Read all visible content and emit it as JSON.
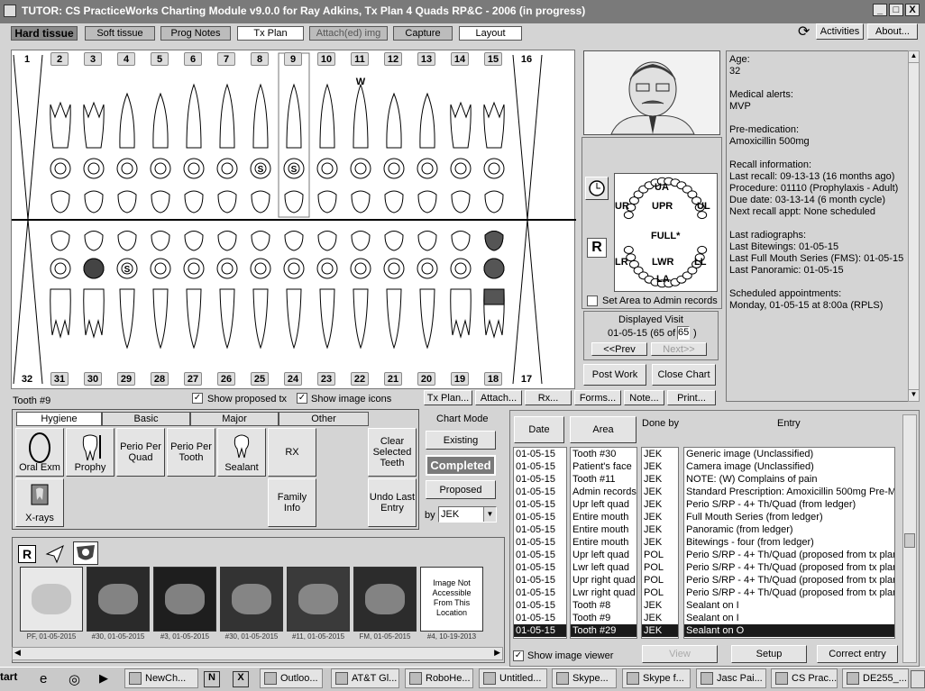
{
  "window": {
    "title": "TUTOR: CS PracticeWorks Charting Module v9.0.0 for Ray Adkins, Tx Plan 4 Quads RP&C - 2006 (in progress)",
    "min": "_",
    "max": "□",
    "close": "X"
  },
  "tabs": [
    "Hard tissue",
    "Soft tissue",
    "Prog Notes",
    "Tx Plan",
    "Attach(ed) img",
    "Capture",
    "Layout"
  ],
  "header_buttons": {
    "activities": "Activities",
    "about": "About..."
  },
  "teeth_top": [
    "1",
    "2",
    "3",
    "4",
    "5",
    "6",
    "7",
    "8",
    "9",
    "10",
    "11",
    "12",
    "13",
    "14",
    "15",
    "16"
  ],
  "teeth_bottom": [
    "32",
    "31",
    "30",
    "29",
    "28",
    "27",
    "26",
    "25",
    "24",
    "23",
    "22",
    "21",
    "20",
    "19",
    "18",
    "17"
  ],
  "marks": {
    "w": "W",
    "s1": "S",
    "s2": "S",
    "s3": "S"
  },
  "chart_bar": {
    "tooth_label": "Tooth #9",
    "show_proposed": "Show proposed tx",
    "show_image_icons": "Show image icons",
    "buttons": [
      "Tx Plan...",
      "Attach...",
      "Rx...",
      "Forms...",
      "Note...",
      "Print..."
    ]
  },
  "patient": {
    "age_label": "Age:",
    "age": "32",
    "alerts_label": "Medical alerts:",
    "alerts": "MVP",
    "premed_label": "Pre-medication:",
    "premed": "Amoxicillin 500mg",
    "recall_label": "Recall information:",
    "recall": [
      "Last recall: 09-13-13 (16 months ago)",
      "Procedure: 01110 (Prophylaxis - Adult)",
      "Due date: 03-13-14 (6 month cycle)",
      "Next recall appt: None scheduled"
    ],
    "radiographs_label": "Last radiographs:",
    "radiographs": [
      "Last Bitewings: 01-05-15",
      "Last Full Mouth Series (FMS): 01-05-15",
      "Last Panoramic: 01-05-15"
    ],
    "sched_label": "Scheduled appointments:",
    "sched": "Monday, 01-05-15 at  8:00a (RPLS)"
  },
  "area_map": {
    "ua": "UA",
    "upr": "UPR",
    "ul": "UL",
    "ur": "UR",
    "full": "FULL*",
    "lr": "LR",
    "lwr": "LWR",
    "ll": "LL",
    "la": "LA",
    "set_area": "Set Area to Admin records",
    "clock_icon": "clock-icon",
    "rx": "R"
  },
  "visit": {
    "label": "Displayed Visit",
    "date": "01-05-15 (65 of",
    "total": "65",
    "close_paren": ")",
    "prev": "<<Prev",
    "next": "Next>>",
    "post_work": "Post Work",
    "close_chart": "Close Chart"
  },
  "proc_tabs": [
    "Hygiene",
    "Basic",
    "Major",
    "Other"
  ],
  "proc_buttons": {
    "oral_exm": "Oral Exm",
    "prophy": "Prophy",
    "perio_quad": "Perio Per Quad",
    "perio_tooth": "Perio Per Tooth",
    "sealant": "Sealant",
    "rx": "RX",
    "xrays": "X-rays",
    "family": "Family Info",
    "clear": "Clear Selected Teeth",
    "undo": "Undo Last Entry"
  },
  "chart_mode": {
    "label": "Chart Mode",
    "existing": "Existing",
    "completed": "Completed",
    "proposed": "Proposed",
    "by_label": "by",
    "by_value": "JEK"
  },
  "images": {
    "r": "R",
    "items": [
      {
        "cap": "PF, 01-05-2015"
      },
      {
        "cap": "#30, 01-05-2015"
      },
      {
        "cap": "#3, 01-05-2015"
      },
      {
        "cap": "#30, 01-05-2015"
      },
      {
        "cap": "#11, 01-05-2015"
      },
      {
        "cap": "FM, 01-05-2015"
      },
      {
        "cap": "#4, 10-19-2013",
        "text": "Image Not Accessible From This Location"
      }
    ]
  },
  "ledger": {
    "headers": {
      "date": "Date",
      "area": "Area",
      "done_by": "Done by",
      "entry": "Entry"
    },
    "rows": [
      {
        "date": "01-05-15",
        "area": "Tooth #30",
        "by": "JEK",
        "entry": "Generic image (Unclassified)"
      },
      {
        "date": "01-05-15",
        "area": "Patient's face",
        "by": "JEK",
        "entry": "Camera image (Unclassified)"
      },
      {
        "date": "01-05-15",
        "area": "Tooth #11",
        "by": "JEK",
        "entry": "NOTE: (W) Complains of pain"
      },
      {
        "date": "01-05-15",
        "area": "Admin records",
        "by": "JEK",
        "entry": "Standard Prescription:  Amoxicillin 500mg Pre-Me"
      },
      {
        "date": "01-05-15",
        "area": "Upr left quad",
        "by": "JEK",
        "entry": "Perio S/RP - 4+ Th/Quad (from ledger)"
      },
      {
        "date": "01-05-15",
        "area": "Entire mouth",
        "by": "JEK",
        "entry": "Full Mouth Series (from ledger)"
      },
      {
        "date": "01-05-15",
        "area": "Entire mouth",
        "by": "JEK",
        "entry": "Panoramic (from ledger)"
      },
      {
        "date": "01-05-15",
        "area": "Entire mouth",
        "by": "JEK",
        "entry": "Bitewings - four (from ledger)"
      },
      {
        "date": "01-05-15",
        "area": "Upr left quad",
        "by": "POL",
        "entry": "Perio S/RP - 4+ Th/Quad (proposed from tx plar"
      },
      {
        "date": "01-05-15",
        "area": "Lwr left quad",
        "by": "POL",
        "entry": "Perio S/RP - 4+ Th/Quad (proposed from tx plar"
      },
      {
        "date": "01-05-15",
        "area": "Upr right quad",
        "by": "POL",
        "entry": "Perio S/RP - 4+ Th/Quad (proposed from tx plar"
      },
      {
        "date": "01-05-15",
        "area": "Lwr right quad",
        "by": "POL",
        "entry": "Perio S/RP - 4+ Th/Quad (proposed from tx plar"
      },
      {
        "date": "01-05-15",
        "area": "Tooth #8",
        "by": "JEK",
        "entry": "Sealant on I"
      },
      {
        "date": "01-05-15",
        "area": "Tooth #9",
        "by": "JEK",
        "entry": "Sealant on I"
      },
      {
        "date": "01-05-15",
        "area": "Tooth #29",
        "by": "JEK",
        "entry": "Sealant on O"
      }
    ],
    "show_viewer": "Show image viewer",
    "view": "View",
    "setup": "Setup",
    "correct": "Correct entry"
  },
  "taskbar": [
    "tart",
    "NewCh...",
    "Outloo...",
    "AT&T Gl...",
    "RoboHe...",
    "Untitled...",
    "Skype...",
    "Skype f...",
    "Jasc Pai...",
    "CS Prac...",
    "DE255_..."
  ]
}
